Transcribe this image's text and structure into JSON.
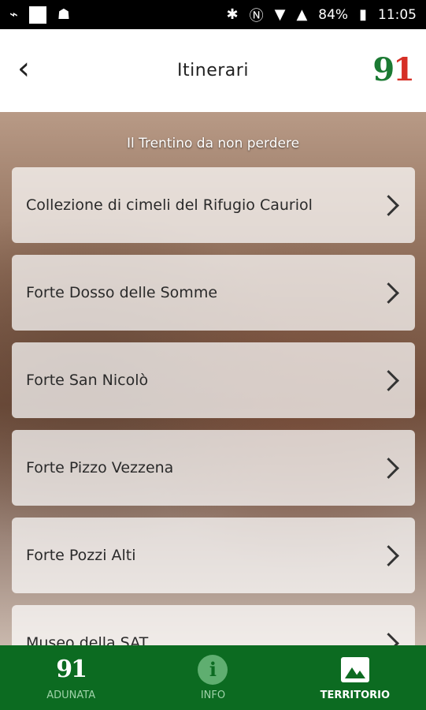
{
  "statusbar": {
    "battery": "84%",
    "time": "11:05"
  },
  "appbar": {
    "title": "Itinerari",
    "logo_main": "9",
    "logo_accent": "1"
  },
  "section": {
    "title": "Il Trentino da non perdere"
  },
  "items": [
    {
      "label": "Collezione di cimeli del Rifugio Cauriol"
    },
    {
      "label": "Forte Dosso delle Somme"
    },
    {
      "label": "Forte San Nicolò"
    },
    {
      "label": "Forte Pizzo Vezzena"
    },
    {
      "label": "Forte Pozzi Alti"
    },
    {
      "label": "Museo della SAT"
    }
  ],
  "nav": [
    {
      "label": "ADUNATA",
      "icon": "logo-91-icon"
    },
    {
      "label": "INFO",
      "icon": "info-icon"
    },
    {
      "label": "TERRITORIO",
      "icon": "image-icon"
    }
  ],
  "colors": {
    "brand_green": "#0c6b21",
    "logo_red": "#d62f26"
  }
}
